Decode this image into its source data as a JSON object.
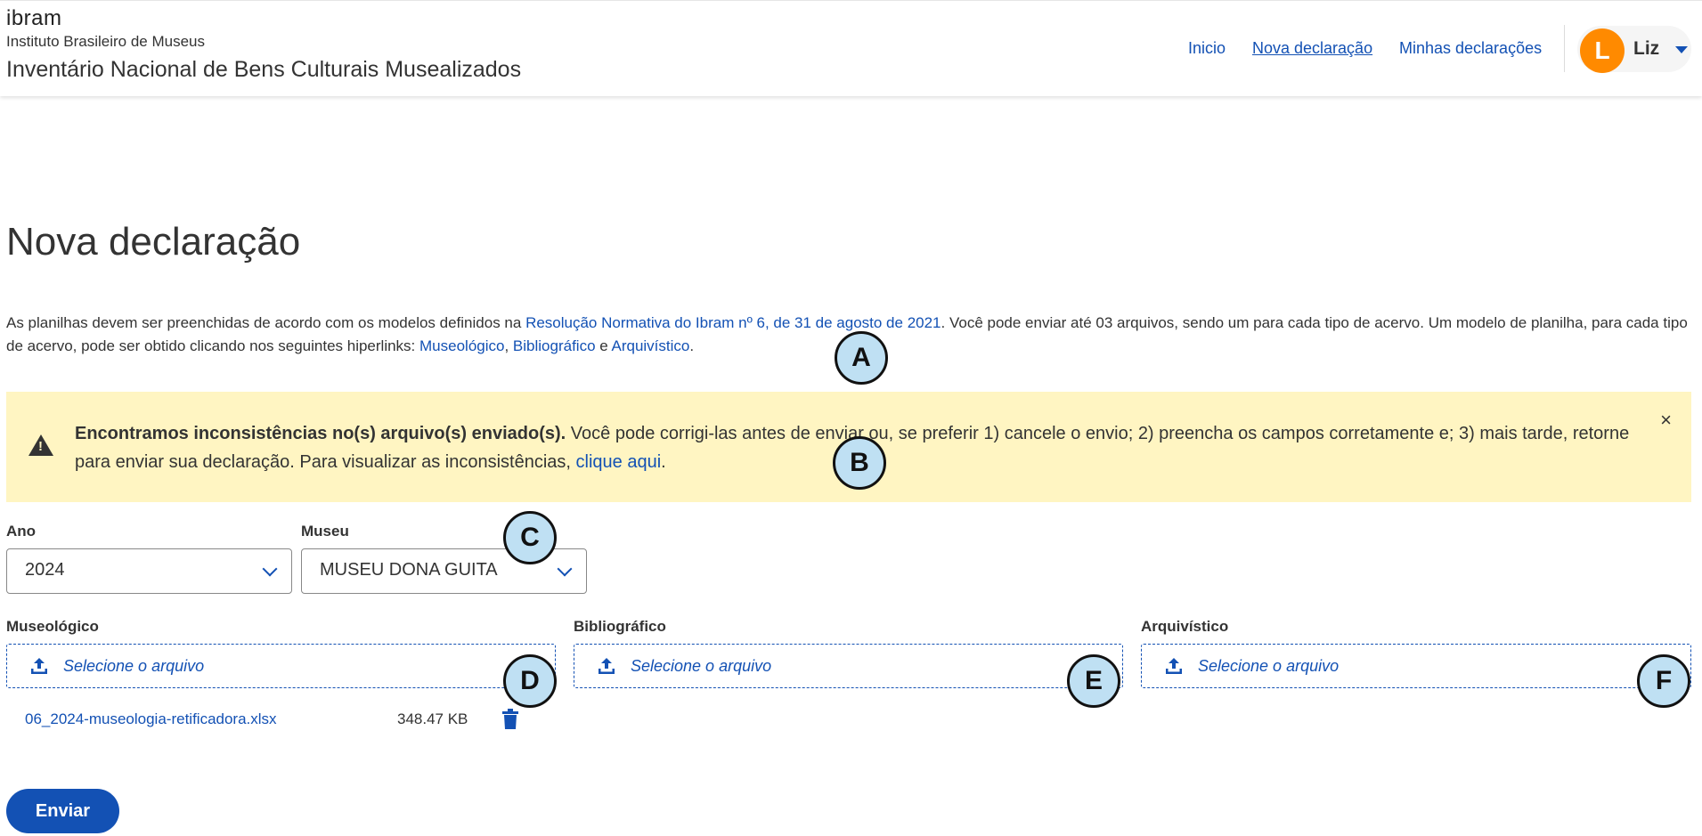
{
  "header": {
    "logo_text": "ibram",
    "org_name": "Instituto Brasileiro de Museus",
    "system_name": "Inventário Nacional de Bens Culturais Musealizados",
    "nav": [
      "Inicio",
      "Nova declaração",
      "Minhas declarações"
    ],
    "user": {
      "initial": "L",
      "name": "Liz"
    }
  },
  "page": {
    "title": "Nova declaração",
    "desc": {
      "part1": "As planilhas devem ser preenchidas de acordo com os modelos definidos na ",
      "link_resolution": "Resolução Normativa do Ibram nº 6, de 31 de agosto de 2021",
      "part2": ". Você pode enviar até 03 arquivos, sendo um para cada tipo de acervo. Um modelo de planilha, para cada tipo de acervo, pode ser obtido clicando nos seguintes hiperlinks: ",
      "link_museologico": "Museológico",
      "sep1": ", ",
      "link_bibliografico": "Bibliográfico",
      "sep2": " e ",
      "link_arquivistico": "Arquivístico",
      "end": "."
    }
  },
  "alert": {
    "bold": "Encontramos inconsistências no(s) arquivo(s) enviado(s).",
    "text": " Você pode corrigi-las antes de enviar ou, se preferir 1) cancele o envio; 2) preencha os campos corretamente e; 3) mais tarde, retorne para enviar sua declaração. Para visualizar as inconsistências, ",
    "link": "clique aqui",
    "end": ".",
    "close": "×"
  },
  "form": {
    "ano": {
      "label": "Ano",
      "value": "2024"
    },
    "museu": {
      "label": "Museu",
      "value": "MUSEU DONA GUITA"
    },
    "uploads": [
      {
        "label": "Museológico",
        "placeholder": "Selecione o arquivo"
      },
      {
        "label": "Bibliográfico",
        "placeholder": "Selecione o arquivo"
      },
      {
        "label": "Arquivístico",
        "placeholder": "Selecione o arquivo"
      }
    ],
    "file": {
      "name": "06_2024-museologia-retificadora.xlsx",
      "size": "348.47 KB"
    },
    "submit": "Enviar"
  },
  "markers": [
    "A",
    "B",
    "C",
    "D",
    "E",
    "F"
  ],
  "colors": {
    "link": "#1351b4",
    "alert_bg": "#fff5c2",
    "avatar": "#ff8a00",
    "marker": "#bfe0f3"
  }
}
